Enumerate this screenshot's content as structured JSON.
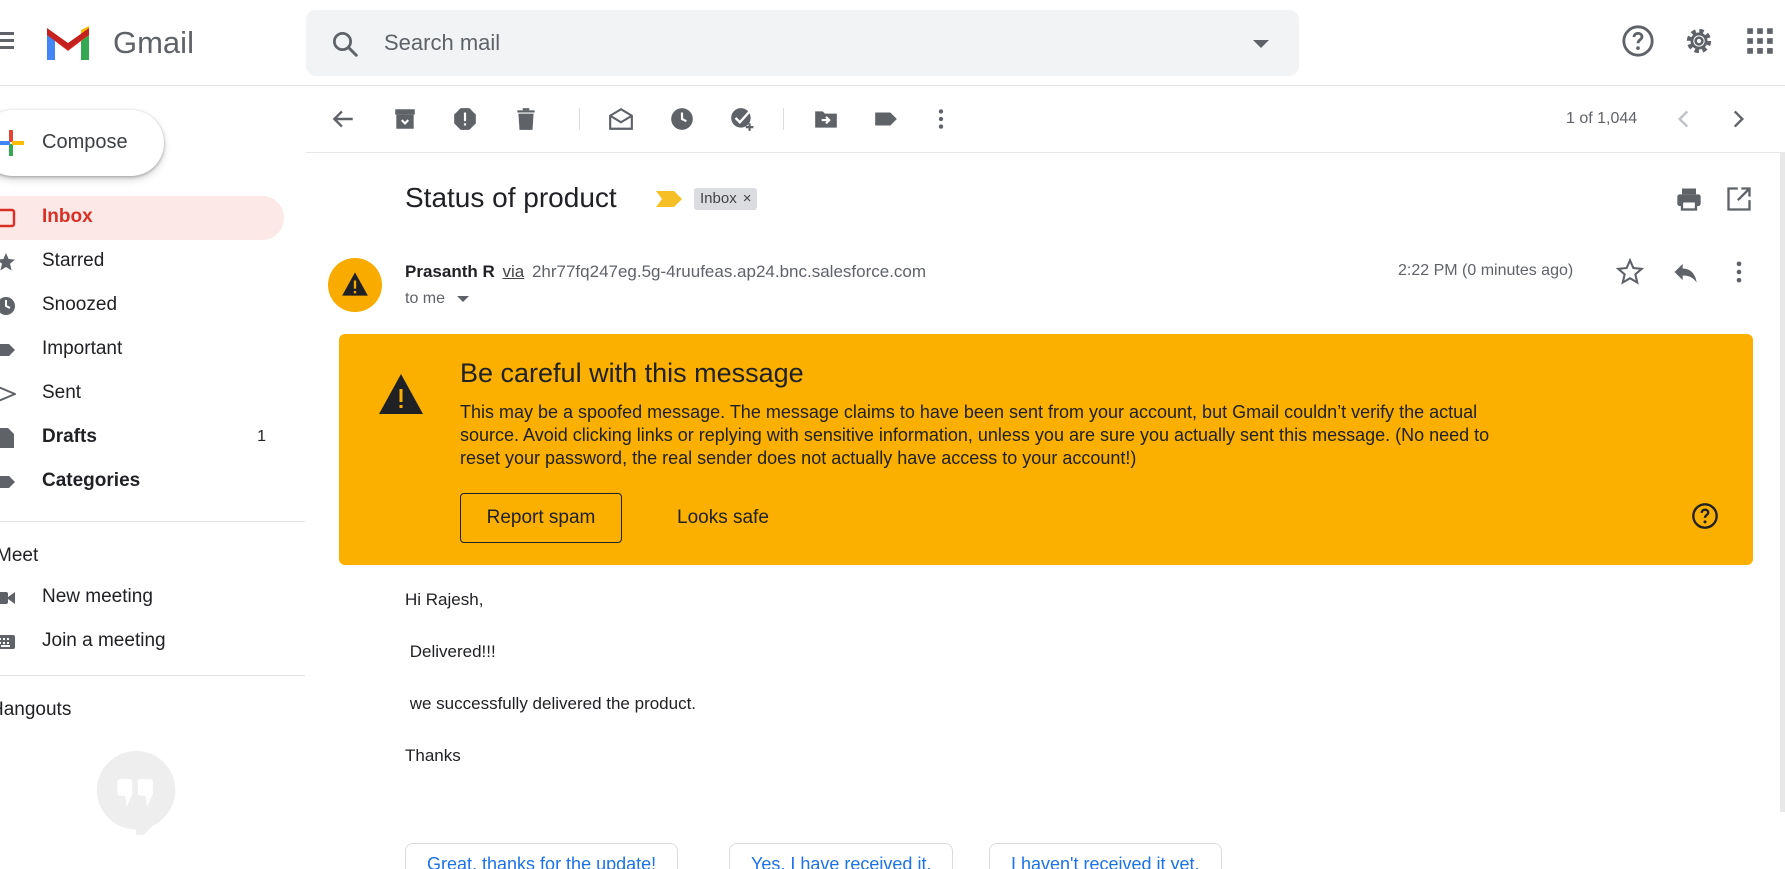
{
  "header": {
    "brand": "Gmail",
    "search_placeholder": "Search mail"
  },
  "sidebar": {
    "compose_label": "Compose",
    "items": [
      {
        "label": "Inbox",
        "count": "",
        "icon": "inbox-icon"
      },
      {
        "label": "Starred",
        "count": "",
        "icon": "star-icon"
      },
      {
        "label": "Snoozed",
        "count": "",
        "icon": "clock-icon"
      },
      {
        "label": "Important",
        "count": "",
        "icon": "label-important-icon"
      },
      {
        "label": "Sent",
        "count": "",
        "icon": "send-icon"
      },
      {
        "label": "Drafts",
        "count": "1",
        "icon": "draft-icon"
      },
      {
        "label": "Categories",
        "count": "",
        "icon": "label-icon"
      }
    ],
    "meet": {
      "title": "Meet",
      "items": [
        {
          "label": "New meeting",
          "icon": "video-icon"
        },
        {
          "label": "Join a meeting",
          "icon": "keyboard-icon"
        }
      ]
    },
    "hangouts_title": "Hangouts"
  },
  "toolbar": {
    "pager": "1 of 1,044"
  },
  "message": {
    "subject": "Status of product",
    "label_chip": "Inbox",
    "chip_close": "×",
    "sender_name": "Prasanth R",
    "via": "via",
    "sender_address": "2hr77fq247eg.5g-4ruufeas.ap24.bnc.salesforce.com",
    "recipient": "to me",
    "timestamp": "2:22 PM (0 minutes ago)"
  },
  "warning": {
    "title": "Be careful with this message",
    "body": "This may be a spoofed message. The message claims to have been sent from your account, but Gmail couldn’t verify the actual source. Avoid clicking links or replying with sensitive information, unless you are sure you actually sent this message. (No need to reset your password, the real sender does not actually have access to your account!)",
    "report_label": "Report spam",
    "safe_label": "Looks safe"
  },
  "body": {
    "lines": [
      "Hi Rajesh,",
      " Delivered!!!",
      " we successfully delivered the product.",
      "Thanks"
    ]
  },
  "smart_replies": [
    "Great, thanks for the update!",
    "Yes, I have received it.",
    "I haven't received it yet."
  ],
  "colors": {
    "warning_bg": "#fbb000",
    "inbox_active_bg": "#fce8e6",
    "inbox_active_text": "#d93025",
    "link_blue": "#1a73e8"
  }
}
